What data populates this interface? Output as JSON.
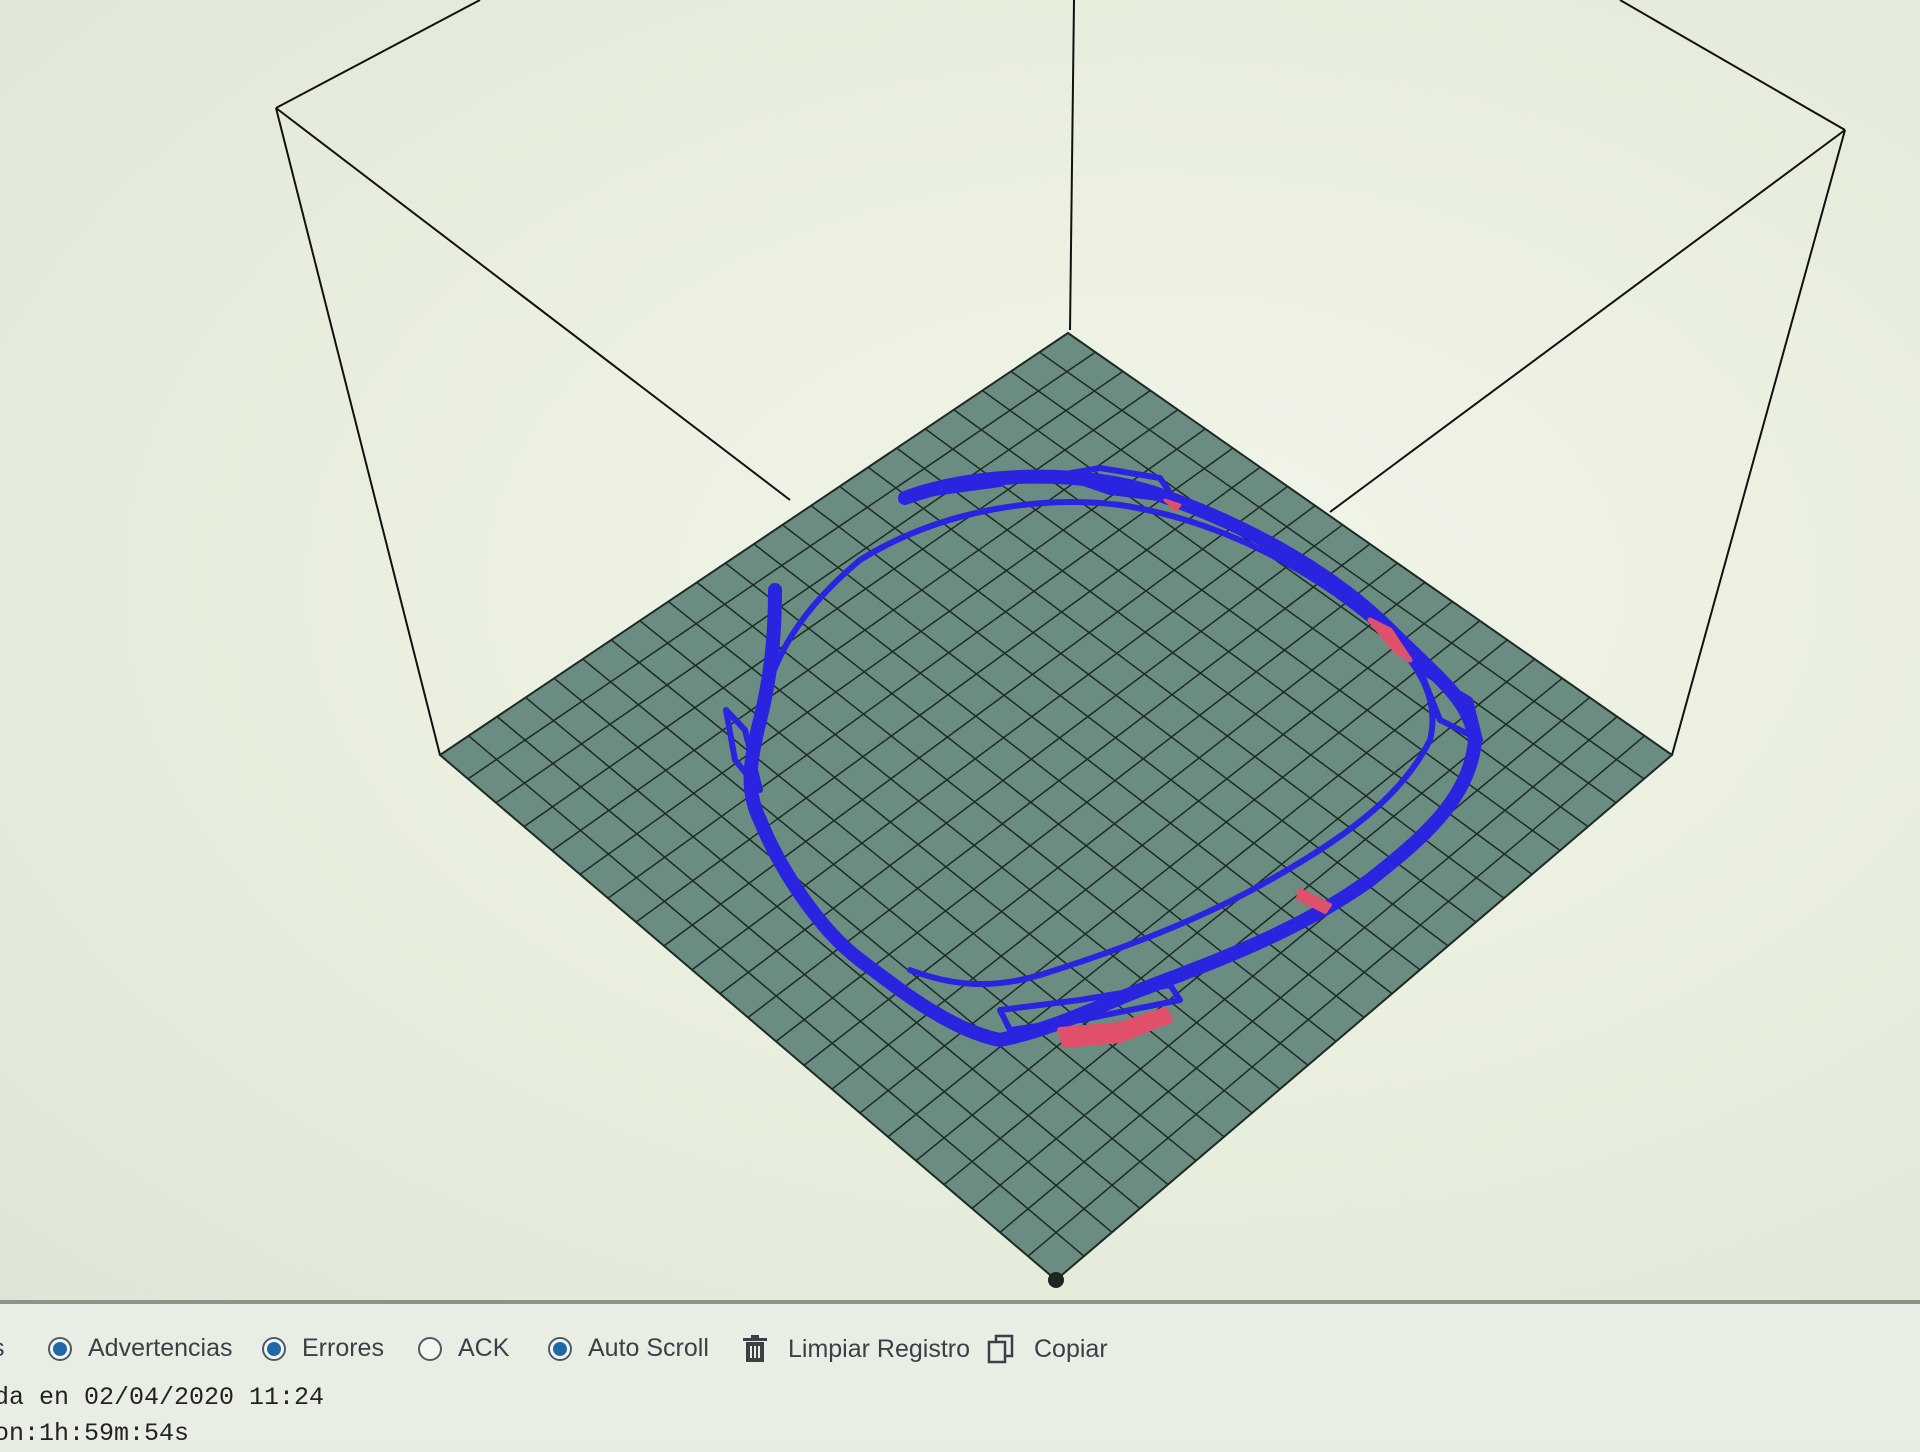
{
  "toolbar": {
    "warnings_label": "Advertencias",
    "warnings_checked": true,
    "errors_label": "Errores",
    "errors_checked": true,
    "ack_label": "ACK",
    "ack_checked": false,
    "autoscroll_label": "Auto Scroll",
    "autoscroll_checked": true,
    "clear_log_label": "Limpiar Registro",
    "copy_label": "Copiar",
    "clear_icon": "trash-icon",
    "copy_icon": "copy-icon"
  },
  "log": {
    "lines": [
      "da en 02/04/2020 11:24",
      "on:1h:59m:54s"
    ]
  },
  "colors": {
    "bed": "#6b8c80",
    "grid": "#1e2a26",
    "toolpath": "#2a24e0",
    "overhang": "#e0506a",
    "accent": "#1f6aa6"
  }
}
